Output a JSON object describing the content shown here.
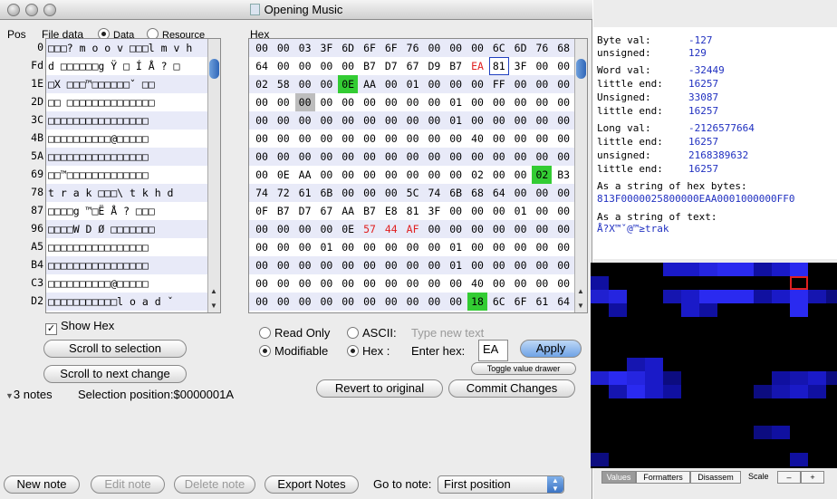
{
  "window": {
    "title": "Opening Music"
  },
  "header": {
    "pos_label": "Pos",
    "file_data_label": "File data",
    "data_radio_label": "Data",
    "resource_radio_label": "Resource",
    "hex_label": "Hex"
  },
  "positions": [
    "0",
    "Fd",
    "1E",
    "2D",
    "3C",
    "4B",
    "5A",
    "69",
    "78",
    "87",
    "96",
    "A5",
    "B4",
    "C3",
    "D2"
  ],
  "ascii_rows": [
    "□□□? m o o v □□□l m v h",
    "d □□□□□□g Ÿ □ Í Å ? □",
    "□X □□□™□□□□□□ˇ □□",
    "□□ □□□□□□□□□□□□□□",
    "□□□□□□□□□□□□□□□□",
    "□□□□□□□□□□@□□□□□",
    "□□□□□□□□□□□□□□□□",
    "□□™□□□□□□□□□□□□□",
    "t r a k □□□\\ t k h d",
    "□□□□g ™□Ë Å ? □□□",
    "□□□□W D Ø □□□□□□□",
    "□□□□□□□□□□□□□□□□",
    "□□□□□□□□□□□□□□□□",
    "□□□□□□□□□□@□□□□□",
    "□□□□□□□□□□□l o a d ˇ"
  ],
  "hex_rows": [
    [
      "00",
      "00",
      "03",
      "3F",
      "6D",
      "6F",
      "6F",
      "76",
      "00",
      "00",
      "00",
      "6C",
      "6D",
      "76",
      "68"
    ],
    [
      "64",
      "00",
      "00",
      "00",
      "00",
      "B7",
      "D7",
      "67",
      "D9",
      "B7",
      "EA",
      "81",
      "3F",
      "00",
      "00"
    ],
    [
      "02",
      "58",
      "00",
      "00",
      "0E",
      "AA",
      "00",
      "01",
      "00",
      "00",
      "00",
      "FF",
      "00",
      "00",
      "00"
    ],
    [
      "00",
      "00",
      "00",
      "00",
      "00",
      "00",
      "00",
      "00",
      "00",
      "01",
      "00",
      "00",
      "00",
      "00",
      "00"
    ],
    [
      "00",
      "00",
      "00",
      "00",
      "00",
      "00",
      "00",
      "00",
      "00",
      "01",
      "00",
      "00",
      "00",
      "00",
      "00"
    ],
    [
      "00",
      "00",
      "00",
      "00",
      "00",
      "00",
      "00",
      "00",
      "00",
      "00",
      "40",
      "00",
      "00",
      "00",
      "00"
    ],
    [
      "00",
      "00",
      "00",
      "00",
      "00",
      "00",
      "00",
      "00",
      "00",
      "00",
      "00",
      "00",
      "00",
      "00",
      "00"
    ],
    [
      "00",
      "0E",
      "AA",
      "00",
      "00",
      "00",
      "00",
      "00",
      "00",
      "00",
      "02",
      "00",
      "00",
      "02",
      "B3"
    ],
    [
      "74",
      "72",
      "61",
      "6B",
      "00",
      "00",
      "00",
      "5C",
      "74",
      "6B",
      "68",
      "64",
      "00",
      "00",
      "00"
    ],
    [
      "0F",
      "B7",
      "D7",
      "67",
      "AA",
      "B7",
      "E8",
      "81",
      "3F",
      "00",
      "00",
      "00",
      "01",
      "00",
      "00"
    ],
    [
      "00",
      "00",
      "00",
      "00",
      "0E",
      "57",
      "44",
      "AF",
      "00",
      "00",
      "00",
      "00",
      "00",
      "00",
      "00"
    ],
    [
      "00",
      "00",
      "00",
      "01",
      "00",
      "00",
      "00",
      "00",
      "00",
      "01",
      "00",
      "00",
      "00",
      "00",
      "00"
    ],
    [
      "00",
      "00",
      "00",
      "00",
      "00",
      "00",
      "00",
      "00",
      "00",
      "01",
      "00",
      "00",
      "00",
      "00",
      "00"
    ],
    [
      "00",
      "00",
      "00",
      "00",
      "00",
      "00",
      "00",
      "00",
      "00",
      "00",
      "40",
      "00",
      "00",
      "00",
      "00"
    ],
    [
      "00",
      "00",
      "00",
      "00",
      "00",
      "00",
      "00",
      "00",
      "00",
      "00",
      "18",
      "6C",
      "6F",
      "61",
      "64",
      "FF"
    ]
  ],
  "controls": {
    "show_hex_label": "Show Hex",
    "scroll_selection": "Scroll to selection",
    "scroll_next_change": "Scroll to next change",
    "notes_count": "3 notes",
    "selection_position": "Selection position:$0000001A",
    "read_only": "Read Only",
    "modifiable": "Modifiable",
    "ascii_label": "ASCII:",
    "ascii_placeholder": "Type new text",
    "hex_radio": "Hex :",
    "enter_hex_label": "Enter hex:",
    "enter_hex_value": "EA",
    "apply": "Apply",
    "toggle_drawer": "Toggle value drawer",
    "revert": "Revert to original",
    "commit": "Commit Changes",
    "new_note": "New note",
    "edit_note": "Edit note",
    "delete_note": "Delete note",
    "export_notes": "Export Notes",
    "go_to_note_label": "Go to note:",
    "go_to_note_value": "First position"
  },
  "values_panel": {
    "byte_label": "Byte  val:",
    "byte_val": "-127",
    "byte_unsigned_label": " unsigned:",
    "byte_unsigned": "129",
    "word_label": "Word  val:",
    "word_val": "-32449",
    "word_little_label": " little end:",
    "word_little": "16257",
    "word_unsigned_label": " Unsigned:",
    "word_unsigned": "33087",
    "word_little2_label": " little end:",
    "word_little2": "16257",
    "long_label": "Long  val:",
    "long_val": "-2126577664",
    "long_little_label": " little end:",
    "long_little": "16257",
    "long_unsigned_label": " unsigned:",
    "long_unsigned": "2168389632",
    "long_little2_label": " little end:",
    "long_little2": "16257",
    "hex_string_label": "As a string of hex bytes:",
    "hex_string": "813F0000025800000EAA0001000000FF0",
    "text_string_label": "As a string of text:",
    "text_string": "Å?X™ˇ@™≥trak"
  },
  "drawer_tabs": [
    "Values",
    "Formatters",
    "Disassem"
  ],
  "drawer_scale_label": "Scale",
  "colors": {
    "highlight_green": "#33cc33",
    "highlight_red": "#e02020",
    "value_blue": "#2030c0",
    "selection_box": "#2040c0"
  }
}
